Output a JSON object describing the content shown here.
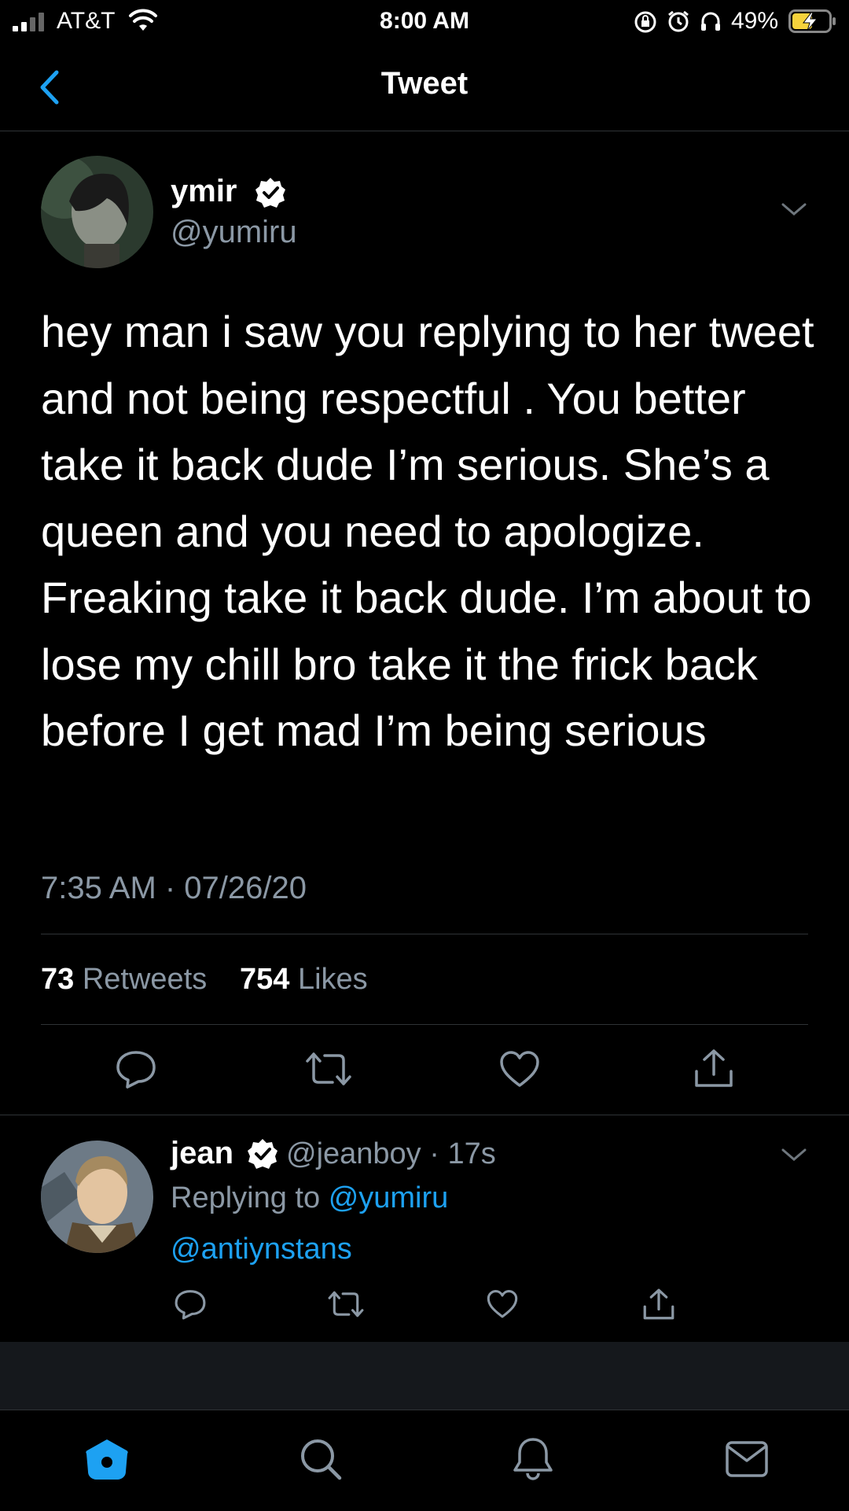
{
  "status_bar": {
    "carrier": "AT&T",
    "time": "8:00 AM",
    "battery": "49%"
  },
  "nav": {
    "title": "Tweet",
    "back_icon": "chevron-left-icon"
  },
  "tweet": {
    "author_name": "ymir",
    "author_handle": "@yumiru",
    "verified_icon": "verified-badge-icon",
    "text": "hey man i saw you replying to her tweet and not being respectful . You better take it back dude I’m serious. She’s a queen and you need to apologize. Freaking take it back dude. I’m about to lose my chill bro take it the frick back before I get mad I’m being serious",
    "timestamp": "7:35 AM · 07/26/20",
    "retweets_count": "73",
    "retweets_label": "Retweets",
    "likes_count": "754",
    "likes_label": "Likes"
  },
  "reply": {
    "author_name": "jean",
    "author_handle": "@jeanboy",
    "time_ago": "· 17s",
    "replying_to_label": "Replying to",
    "replying_to_handle": "@yumiru",
    "text": "@antiynstans"
  },
  "tab_bar": {
    "items": [
      "home-icon",
      "search-icon",
      "bell-icon",
      "mail-icon"
    ]
  },
  "colors": {
    "background": "#000000",
    "accent": "#1da1f2",
    "muted": "#8b98a5",
    "divider": "#2f3336"
  }
}
